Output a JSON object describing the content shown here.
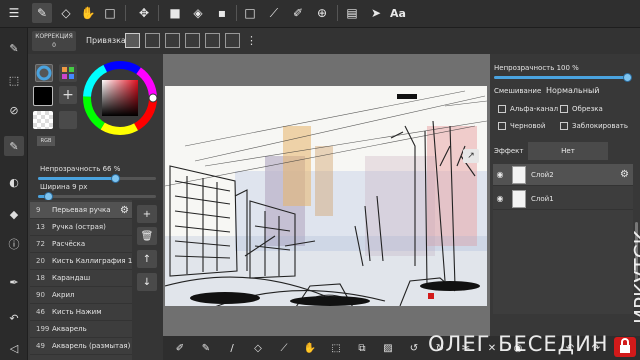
{
  "toolbar": {
    "icons": [
      "pen-icon",
      "eraser-icon",
      "hand-icon",
      "rectangle-select-icon",
      "move-icon",
      "fill-color-icon",
      "bucket-icon",
      "square-icon",
      "eyedropper-icon",
      "pen-edit-icon",
      "add-layer-icon",
      "layout-icon",
      "pointer-icon",
      "text-icon"
    ],
    "text_label": "Aa"
  },
  "subbar": {
    "correction_label": "КОРРЕКЦИЯ",
    "correction_value": "0",
    "snap_label": "Привязка"
  },
  "properties": {
    "opacity_label": "Непрозрачность 66 %",
    "opacity_value": 0.66,
    "width_label": "Ширина 9 px",
    "width_value": 0.09
  },
  "color": {
    "primary": "#000000",
    "accent": "#4aa3df",
    "rgb_label": "RGB"
  },
  "brushes": [
    {
      "num": "9",
      "name": "Перьевая ручка",
      "selected": true
    },
    {
      "num": "13",
      "name": "Ручка (острая)",
      "selected": false
    },
    {
      "num": "72",
      "name": "Расчёска",
      "selected": false
    },
    {
      "num": "20",
      "name": "Кисть Каллиграфия 1",
      "selected": false
    },
    {
      "num": "18",
      "name": "Карандаш",
      "selected": false
    },
    {
      "num": "90",
      "name": "Акрил",
      "selected": false
    },
    {
      "num": "46",
      "name": "Кисть Нажим",
      "selected": false
    },
    {
      "num": "199",
      "name": "Акварель",
      "selected": false
    },
    {
      "num": "49",
      "name": "Акварель (размытая)",
      "selected": false
    }
  ],
  "layer_panel": {
    "opacity_label": "Непрозрачность 100 %",
    "opacity_value": 1.0,
    "blend_label": "Смешивание",
    "blend_value": "Нормальный",
    "alpha_label": "Альфа-канал",
    "clip_label": "Обрезка",
    "draft_label": "Черновой",
    "lock_label": "Заблокировать",
    "effect_label": "Эффект",
    "effect_value": "Нет",
    "layers": [
      {
        "name": "Слой2",
        "selected": true
      },
      {
        "name": "Слой1",
        "selected": false
      }
    ]
  },
  "watermark": {
    "text": "ОЛЕГ БЕСЕДИН",
    "vertical": "ИРКУТСК"
  }
}
